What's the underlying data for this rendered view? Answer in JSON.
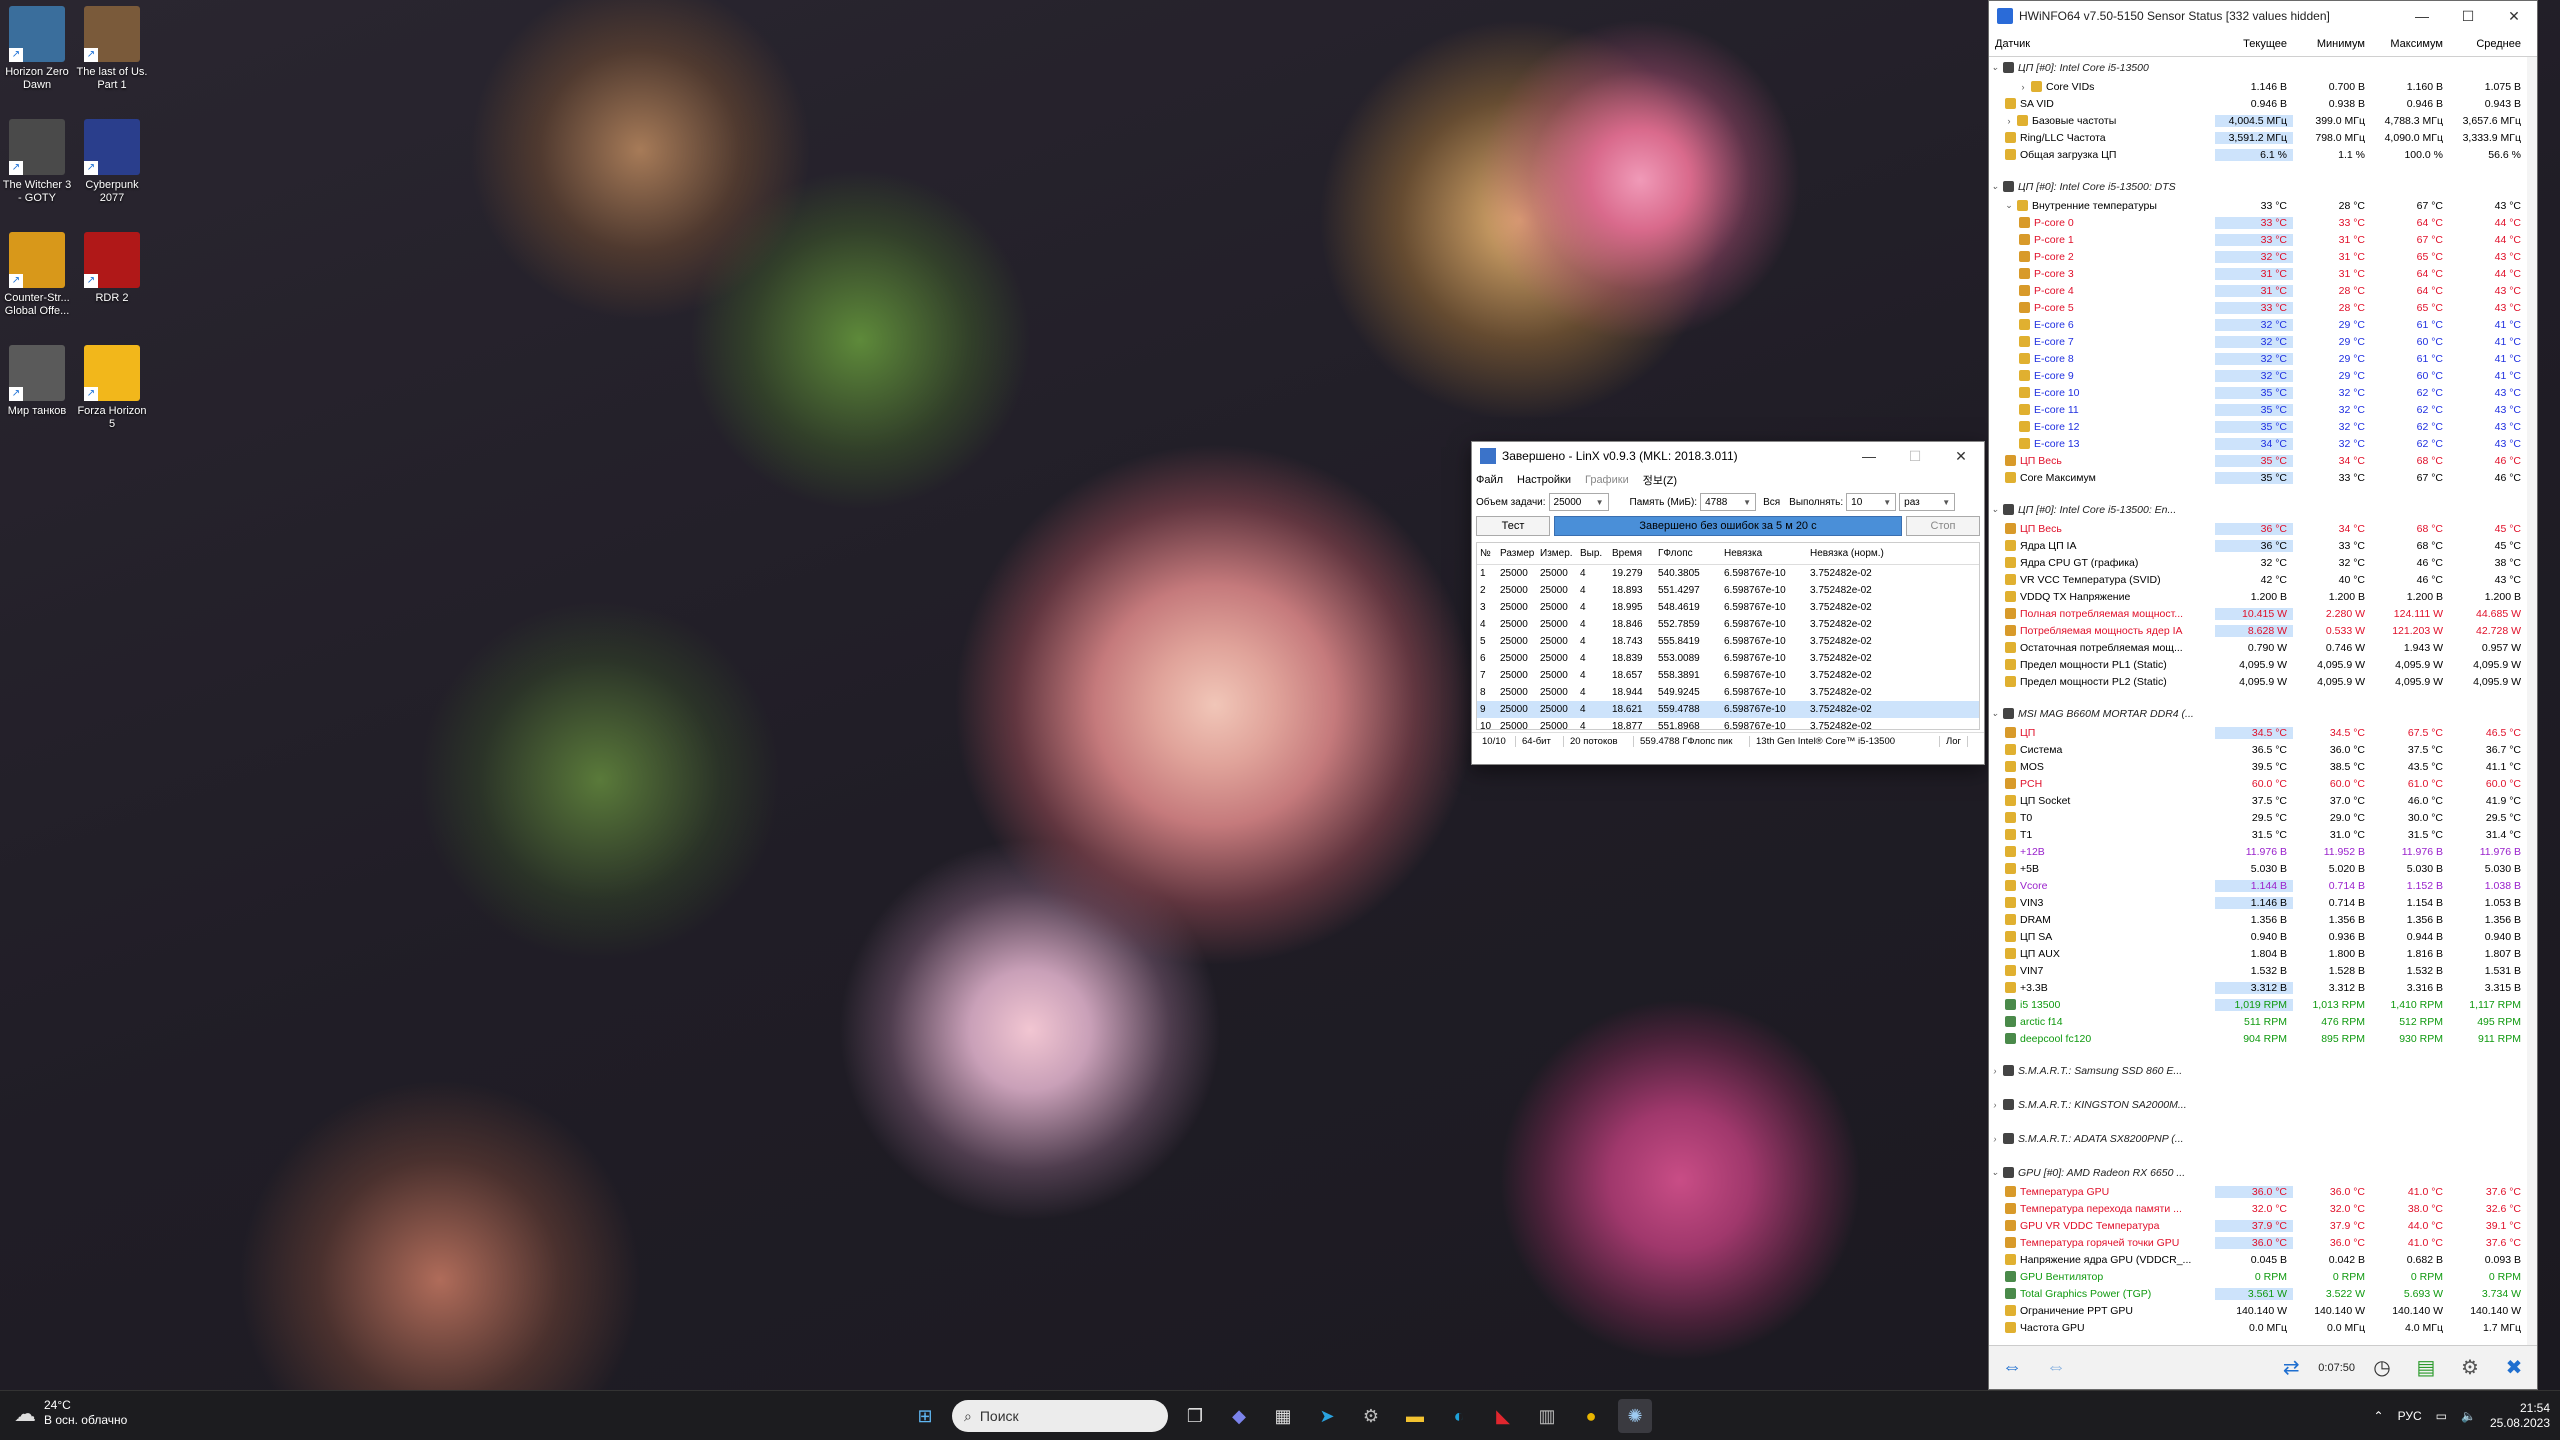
{
  "desktop": {
    "icons": [
      {
        "label": "Horizon Zero Dawn",
        "color": "#3a6e9c"
      },
      {
        "label": "The last of Us. Part 1",
        "color": "#7a5a3a"
      },
      {
        "label": "The Witcher 3 - GOTY",
        "color": "#4a4a4a"
      },
      {
        "label": "Cyberpunk 2077",
        "color": "#2a3e8c"
      },
      {
        "label": "Counter-Str... Global Offe...",
        "color": "#d8981a"
      },
      {
        "label": "RDR 2",
        "color": "#b01818"
      },
      {
        "label": "Мир танков",
        "color": "#5a5a5a"
      },
      {
        "label": "Forza Horizon 5",
        "color": "#f2b71b"
      }
    ]
  },
  "hwinfo": {
    "title": "HWiNFO64 v7.50-5150 Sensor Status [332 values hidden]",
    "columns": [
      "Датчик",
      "Текущее",
      "Минимум",
      "Максимум",
      "Среднее"
    ],
    "rows": [
      {
        "t": "g",
        "name": "ЦП [#0]: Intel Core i5-13500"
      },
      {
        "t": "r",
        "name": "Core VIDs",
        "ind": 1,
        "exp": ">",
        "cur": "1.146 В",
        "min": "0.700 В",
        "max": "1.160 В",
        "avg": "1.075 В"
      },
      {
        "t": "r",
        "name": "SA VID",
        "ind": 0,
        "cur": "0.946 В",
        "min": "0.938 В",
        "max": "0.946 В",
        "avg": "0.943 В"
      },
      {
        "t": "r",
        "name": "Базовые частоты",
        "ind": 0,
        "exp": ">",
        "cur": "4,004.5 МГц",
        "min": "399.0 МГц",
        "max": "4,788.3 МГц",
        "avg": "3,657.6 МГц",
        "hl": true
      },
      {
        "t": "r",
        "name": "Ring/LLC Частота",
        "ind": 0,
        "cur": "3,591.2 МГц",
        "min": "798.0 МГц",
        "max": "4,090.0 МГц",
        "avg": "3,333.9 МГц",
        "hl": true
      },
      {
        "t": "r",
        "name": "Общая загрузка ЦП",
        "ind": 0,
        "cur": "6.1 %",
        "min": "1.1 %",
        "max": "100.0 %",
        "avg": "56.6 %",
        "hl": true
      },
      {
        "t": "s"
      },
      {
        "t": "g",
        "name": "ЦП [#0]: Intel Core i5-13500: DTS"
      },
      {
        "t": "r",
        "name": "Внутренние температуры",
        "ind": 0,
        "exp": "v",
        "cur": "33 °C",
        "min": "28 °C",
        "max": "67 °C",
        "avg": "43 °C"
      },
      {
        "t": "r",
        "name": "P-core 0",
        "ind": 1,
        "c": "red",
        "cur": "33 °C",
        "min": "33 °C",
        "max": "64 °C",
        "avg": "44 °C",
        "hl": true
      },
      {
        "t": "r",
        "name": "P-core 1",
        "ind": 1,
        "c": "red",
        "cur": "33 °C",
        "min": "31 °C",
        "max": "67 °C",
        "avg": "44 °C",
        "hl": true
      },
      {
        "t": "r",
        "name": "P-core 2",
        "ind": 1,
        "c": "red",
        "cur": "32 °C",
        "min": "31 °C",
        "max": "65 °C",
        "avg": "43 °C",
        "hl": true
      },
      {
        "t": "r",
        "name": "P-core 3",
        "ind": 1,
        "c": "red",
        "cur": "31 °C",
        "min": "31 °C",
        "max": "64 °C",
        "avg": "44 °C",
        "hl": true
      },
      {
        "t": "r",
        "name": "P-core 4",
        "ind": 1,
        "c": "red",
        "cur": "31 °C",
        "min": "28 °C",
        "max": "64 °C",
        "avg": "43 °C",
        "hl": true
      },
      {
        "t": "r",
        "name": "P-core 5",
        "ind": 1,
        "c": "red",
        "cur": "33 °C",
        "min": "28 °C",
        "max": "65 °C",
        "avg": "43 °C",
        "hl": true
      },
      {
        "t": "r",
        "name": "E-core 6",
        "ind": 1,
        "c": "blue",
        "cur": "32 °C",
        "min": "29 °C",
        "max": "61 °C",
        "avg": "41 °C",
        "hl": true
      },
      {
        "t": "r",
        "name": "E-core 7",
        "ind": 1,
        "c": "blue",
        "cur": "32 °C",
        "min": "29 °C",
        "max": "60 °C",
        "avg": "41 °C",
        "hl": true
      },
      {
        "t": "r",
        "name": "E-core 8",
        "ind": 1,
        "c": "blue",
        "cur": "32 °C",
        "min": "29 °C",
        "max": "61 °C",
        "avg": "41 °C",
        "hl": true
      },
      {
        "t": "r",
        "name": "E-core 9",
        "ind": 1,
        "c": "blue",
        "cur": "32 °C",
        "min": "29 °C",
        "max": "60 °C",
        "avg": "41 °C",
        "hl": true
      },
      {
        "t": "r",
        "name": "E-core 10",
        "ind": 1,
        "c": "blue",
        "cur": "35 °C",
        "min": "32 °C",
        "max": "62 °C",
        "avg": "43 °C",
        "hl": true
      },
      {
        "t": "r",
        "name": "E-core 11",
        "ind": 1,
        "c": "blue",
        "cur": "35 °C",
        "min": "32 °C",
        "max": "62 °C",
        "avg": "43 °C",
        "hl": true
      },
      {
        "t": "r",
        "name": "E-core 12",
        "ind": 1,
        "c": "blue",
        "cur": "35 °C",
        "min": "32 °C",
        "max": "62 °C",
        "avg": "43 °C",
        "hl": true
      },
      {
        "t": "r",
        "name": "E-core 13",
        "ind": 1,
        "c": "blue",
        "cur": "34 °C",
        "min": "32 °C",
        "max": "62 °C",
        "avg": "43 °C",
        "hl": true
      },
      {
        "t": "r",
        "name": "ЦП Весь",
        "ind": 0,
        "c": "red",
        "cur": "35 °C",
        "min": "34 °C",
        "max": "68 °C",
        "avg": "46 °C",
        "hl": true
      },
      {
        "t": "r",
        "name": "Core Максимум",
        "ind": 0,
        "cur": "35 °C",
        "min": "33 °C",
        "max": "67 °C",
        "avg": "46 °C",
        "hl": true
      },
      {
        "t": "s"
      },
      {
        "t": "g",
        "name": "ЦП [#0]: Intel Core i5-13500: En..."
      },
      {
        "t": "r",
        "name": "ЦП Весь",
        "ind": 0,
        "c": "red",
        "cur": "36 °C",
        "min": "34 °C",
        "max": "68 °C",
        "avg": "45 °C",
        "hl": true
      },
      {
        "t": "r",
        "name": "Ядра ЦП IA",
        "ind": 0,
        "cur": "36 °C",
        "min": "33 °C",
        "max": "68 °C",
        "avg": "45 °C",
        "hl": true
      },
      {
        "t": "r",
        "name": "Ядра CPU GT (графика)",
        "ind": 0,
        "cur": "32 °C",
        "min": "32 °C",
        "max": "46 °C",
        "avg": "38 °C"
      },
      {
        "t": "r",
        "name": "VR VCC Температура (SVID)",
        "ind": 0,
        "cur": "42 °C",
        "min": "40 °C",
        "max": "46 °C",
        "avg": "43 °C"
      },
      {
        "t": "r",
        "name": "VDDQ TX Напряжение",
        "ind": 0,
        "cur": "1.200 В",
        "min": "1.200 В",
        "max": "1.200 В",
        "avg": "1.200 В"
      },
      {
        "t": "r",
        "name": "Полная потребляемая мощност...",
        "ind": 0,
        "c": "red",
        "cur": "10.415 W",
        "min": "2.280 W",
        "max": "124.111 W",
        "avg": "44.685 W",
        "hl": true
      },
      {
        "t": "r",
        "name": "Потребляемая мощность ядер IA",
        "ind": 0,
        "c": "red",
        "cur": "8.628 W",
        "min": "0.533 W",
        "max": "121.203 W",
        "avg": "42.728 W",
        "hl": true
      },
      {
        "t": "r",
        "name": "Остаточная потребляемая мощ...",
        "ind": 0,
        "cur": "0.790 W",
        "min": "0.746 W",
        "max": "1.943 W",
        "avg": "0.957 W"
      },
      {
        "t": "r",
        "name": "Предел мощности PL1 (Static)",
        "ind": 0,
        "cur": "4,095.9 W",
        "min": "4,095.9 W",
        "max": "4,095.9 W",
        "avg": "4,095.9 W"
      },
      {
        "t": "r",
        "name": "Предел мощности PL2 (Static)",
        "ind": 0,
        "cur": "4,095.9 W",
        "min": "4,095.9 W",
        "max": "4,095.9 W",
        "avg": "4,095.9 W"
      },
      {
        "t": "s"
      },
      {
        "t": "g",
        "name": "MSI MAG B660M MORTAR DDR4 (..."
      },
      {
        "t": "r",
        "name": "ЦП",
        "ind": 0,
        "c": "red",
        "cur": "34.5 °C",
        "min": "34.5 °C",
        "max": "67.5 °C",
        "avg": "46.5 °C",
        "hl": true
      },
      {
        "t": "r",
        "name": "Система",
        "ind": 0,
        "cur": "36.5 °C",
        "min": "36.0 °C",
        "max": "37.5 °C",
        "avg": "36.7 °C"
      },
      {
        "t": "r",
        "name": "MOS",
        "ind": 0,
        "cur": "39.5 °C",
        "min": "38.5 °C",
        "max": "43.5 °C",
        "avg": "41.1 °C"
      },
      {
        "t": "r",
        "name": "PCH",
        "ind": 0,
        "c": "red",
        "cur": "60.0 °C",
        "min": "60.0 °C",
        "max": "61.0 °C",
        "avg": "60.0 °C"
      },
      {
        "t": "r",
        "name": "ЦП Socket",
        "ind": 0,
        "cur": "37.5 °C",
        "min": "37.0 °C",
        "max": "46.0 °C",
        "avg": "41.9 °C"
      },
      {
        "t": "r",
        "name": "T0",
        "ind": 0,
        "cur": "29.5 °C",
        "min": "29.0 °C",
        "max": "30.0 °C",
        "avg": "29.5 °C"
      },
      {
        "t": "r",
        "name": "T1",
        "ind": 0,
        "cur": "31.5 °C",
        "min": "31.0 °C",
        "max": "31.5 °C",
        "avg": "31.4 °C"
      },
      {
        "t": "r",
        "name": "+12В",
        "ind": 0,
        "c": "purple",
        "cur": "11.976 В",
        "min": "11.952 В",
        "max": "11.976 В",
        "avg": "11.976 В"
      },
      {
        "t": "r",
        "name": "+5В",
        "ind": 0,
        "cur": "5.030 В",
        "min": "5.020 В",
        "max": "5.030 В",
        "avg": "5.030 В"
      },
      {
        "t": "r",
        "name": "Vcore",
        "ind": 0,
        "c": "purple",
        "cur": "1.144 В",
        "min": "0.714 В",
        "max": "1.152 В",
        "avg": "1.038 В",
        "hl": true
      },
      {
        "t": "r",
        "name": "VIN3",
        "ind": 0,
        "cur": "1.146 В",
        "min": "0.714 В",
        "max": "1.154 В",
        "avg": "1.053 В",
        "hl": true
      },
      {
        "t": "r",
        "name": "DRAM",
        "ind": 0,
        "cur": "1.356 В",
        "min": "1.356 В",
        "max": "1.356 В",
        "avg": "1.356 В"
      },
      {
        "t": "r",
        "name": "ЦП SA",
        "ind": 0,
        "cur": "0.940 В",
        "min": "0.936 В",
        "max": "0.944 В",
        "avg": "0.940 В"
      },
      {
        "t": "r",
        "name": "ЦП AUX",
        "ind": 0,
        "cur": "1.804 В",
        "min": "1.800 В",
        "max": "1.816 В",
        "avg": "1.807 В"
      },
      {
        "t": "r",
        "name": "VIN7",
        "ind": 0,
        "cur": "1.532 В",
        "min": "1.528 В",
        "max": "1.532 В",
        "avg": "1.531 В"
      },
      {
        "t": "r",
        "name": "+3.3В",
        "ind": 0,
        "cur": "3.312 В",
        "min": "3.312 В",
        "max": "3.316 В",
        "avg": "3.315 В",
        "hl": true
      },
      {
        "t": "r",
        "name": "i5 13500",
        "ind": 0,
        "c": "green",
        "cur": "1,019 RPM",
        "min": "1,013 RPM",
        "max": "1,410 RPM",
        "avg": "1,117 RPM",
        "hl": true
      },
      {
        "t": "r",
        "name": "arctic f14",
        "ind": 0,
        "c": "green",
        "cur": "511 RPM",
        "min": "476 RPM",
        "max": "512 RPM",
        "avg": "495 RPM"
      },
      {
        "t": "r",
        "name": "deepcool fc120",
        "ind": 0,
        "c": "green",
        "cur": "904 RPM",
        "min": "895 RPM",
        "max": "930 RPM",
        "avg": "911 RPM"
      },
      {
        "t": "s"
      },
      {
        "t": "g",
        "name": "S.M.A.R.T.: Samsung SSD 860 E...",
        "exp": ">"
      },
      {
        "t": "s"
      },
      {
        "t": "g",
        "name": "S.M.A.R.T.: KINGSTON SA2000M...",
        "exp": ">"
      },
      {
        "t": "s"
      },
      {
        "t": "g",
        "name": "S.M.A.R.T.: ADATA SX8200PNP (...",
        "exp": ">"
      },
      {
        "t": "s"
      },
      {
        "t": "g",
        "name": "GPU [#0]: AMD Radeon RX 6650 ..."
      },
      {
        "t": "r",
        "name": "Температура GPU",
        "ind": 0,
        "c": "red",
        "cur": "36.0 °C",
        "min": "36.0 °C",
        "max": "41.0 °C",
        "avg": "37.6 °C",
        "hl": true
      },
      {
        "t": "r",
        "name": "Температура перехода памяти ...",
        "ind": 0,
        "c": "red",
        "cur": "32.0 °C",
        "min": "32.0 °C",
        "max": "38.0 °C",
        "avg": "32.6 °C"
      },
      {
        "t": "r",
        "name": "GPU VR VDDC Температура",
        "ind": 0,
        "c": "red",
        "cur": "37.9 °C",
        "min": "37.9 °C",
        "max": "44.0 °C",
        "avg": "39.1 °C",
        "hl": true
      },
      {
        "t": "r",
        "name": "Температура горячей точки GPU",
        "ind": 0,
        "c": "red",
        "cur": "36.0 °C",
        "min": "36.0 °C",
        "max": "41.0 °C",
        "avg": "37.6 °C",
        "hl": true
      },
      {
        "t": "r",
        "name": "Напряжение ядра GPU (VDDCR_...",
        "ind": 0,
        "cur": "0.045 В",
        "min": "0.042 В",
        "max": "0.682 В",
        "avg": "0.093 В"
      },
      {
        "t": "r",
        "name": "GPU Вентилятор",
        "ind": 0,
        "c": "green",
        "cur": "0 RPM",
        "min": "0 RPM",
        "max": "0 RPM",
        "avg": "0 RPM"
      },
      {
        "t": "r",
        "name": "Total Graphics Power (TGP)",
        "ind": 0,
        "c": "green",
        "cur": "3.561 W",
        "min": "3.522 W",
        "max": "5.693 W",
        "avg": "3.734 W",
        "hl": true
      },
      {
        "t": "r",
        "name": "Ограничение PPT GPU",
        "ind": 0,
        "cur": "140.140 W",
        "min": "140.140 W",
        "max": "140.140 W",
        "avg": "140.140 W"
      },
      {
        "t": "r",
        "name": "Частота GPU",
        "ind": 0,
        "cur": "0.0 МГц",
        "min": "0.0 МГц",
        "max": "4.0 МГц",
        "avg": "1.7 МГц"
      }
    ],
    "elapsed": "0:07:50"
  },
  "linx": {
    "title": "Завершено - LinX v0.9.3 (MKL: 2018.3.011)",
    "menu": [
      "Файл",
      "Настройки",
      "Графики",
      "정보(Z)"
    ],
    "task_size_label": "Объем задачи:",
    "task_size": "25000",
    "memory_label": "Память (МиБ):",
    "memory": "4788",
    "all_label": "Вся",
    "run_label": "Выполнять:",
    "run_count": "10",
    "run_unit": "раз",
    "test_button": "Тест",
    "progress_text": "Завершено без ошибок за 5 м 20 с",
    "progress": 1.0,
    "stop_button": "Стоп",
    "columns": [
      "№",
      "Размер",
      "Измер.",
      "Выр.",
      "Время",
      "ГФлопс",
      "Невязка",
      "Невязка (норм.)"
    ],
    "rows": [
      [
        "1",
        "25000",
        "25000",
        "4",
        "19.279",
        "540.3805",
        "6.598767e-10",
        "3.752482e-02"
      ],
      [
        "2",
        "25000",
        "25000",
        "4",
        "18.893",
        "551.4297",
        "6.598767e-10",
        "3.752482e-02"
      ],
      [
        "3",
        "25000",
        "25000",
        "4",
        "18.995",
        "548.4619",
        "6.598767e-10",
        "3.752482e-02"
      ],
      [
        "4",
        "25000",
        "25000",
        "4",
        "18.846",
        "552.7859",
        "6.598767e-10",
        "3.752482e-02"
      ],
      [
        "5",
        "25000",
        "25000",
        "4",
        "18.743",
        "555.8419",
        "6.598767e-10",
        "3.752482e-02"
      ],
      [
        "6",
        "25000",
        "25000",
        "4",
        "18.839",
        "553.0089",
        "6.598767e-10",
        "3.752482e-02"
      ],
      [
        "7",
        "25000",
        "25000",
        "4",
        "18.657",
        "558.3891",
        "6.598767e-10",
        "3.752482e-02"
      ],
      [
        "8",
        "25000",
        "25000",
        "4",
        "18.944",
        "549.9245",
        "6.598767e-10",
        "3.752482e-02"
      ],
      [
        "9",
        "25000",
        "25000",
        "4",
        "18.621",
        "559.4788",
        "6.598767e-10",
        "3.752482e-02"
      ],
      [
        "10",
        "25000",
        "25000",
        "4",
        "18.877",
        "551.8968",
        "6.598767e-10",
        "3.752482e-02"
      ]
    ],
    "selected_row": 8,
    "status": [
      "10/10",
      "64-бит",
      "20 потоков",
      "559.4788 ГФлопс пик",
      "13th Gen Intel® Core™ i5-13500",
      "Лог"
    ]
  },
  "taskbar": {
    "weather_temp": "24°C",
    "weather_desc": "В осн. облачно",
    "search_placeholder": "Поиск",
    "lang": "РУС",
    "time": "21:54",
    "date": "25.08.2023",
    "apps": [
      {
        "icon": "task-view-icon",
        "glyph": "❐",
        "color": "#ddd"
      },
      {
        "icon": "teams-icon",
        "glyph": "◆",
        "color": "#7b83eb"
      },
      {
        "icon": "store-icon",
        "glyph": "▦",
        "color": "#ddd"
      },
      {
        "icon": "telegram-icon",
        "glyph": "➤",
        "color": "#2aa3e0"
      },
      {
        "icon": "settings-icon",
        "glyph": "⚙",
        "color": "#bbb"
      },
      {
        "icon": "file-explorer-icon",
        "glyph": "▬",
        "color": "#f2c230"
      },
      {
        "icon": "edge-icon",
        "glyph": "◐",
        "color": "#1ea1d9"
      },
      {
        "icon": "amd-icon",
        "glyph": "◣",
        "color": "#e0262e"
      },
      {
        "icon": "hwinfo-taskbar-icon",
        "glyph": "▥",
        "color": "#bbb"
      },
      {
        "icon": "chrome-icon",
        "glyph": "●",
        "color": "#e8b500"
      },
      {
        "icon": "linx-taskbar-icon",
        "glyph": "✺",
        "color": "#9ecbf2"
      }
    ]
  }
}
